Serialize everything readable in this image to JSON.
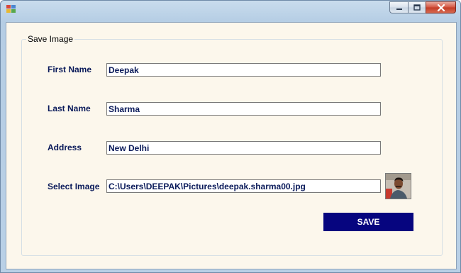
{
  "window": {
    "title": ""
  },
  "group": {
    "label": "Save Image"
  },
  "form": {
    "first_name": {
      "label": "First Name",
      "value": "Deepak"
    },
    "last_name": {
      "label": "Last Name",
      "value": "Sharma"
    },
    "address": {
      "label": "Address",
      "value": "New Delhi"
    },
    "image": {
      "label": "Select Image",
      "value": "C:\\Users\\DEEPAK\\Pictures\\deepak.sharma00.jpg"
    }
  },
  "save_button": {
    "label": "SAVE"
  },
  "colors": {
    "button_bg": "#06057f",
    "label_text": "#0a1a5a",
    "form_bg": "#fcf7ec"
  }
}
